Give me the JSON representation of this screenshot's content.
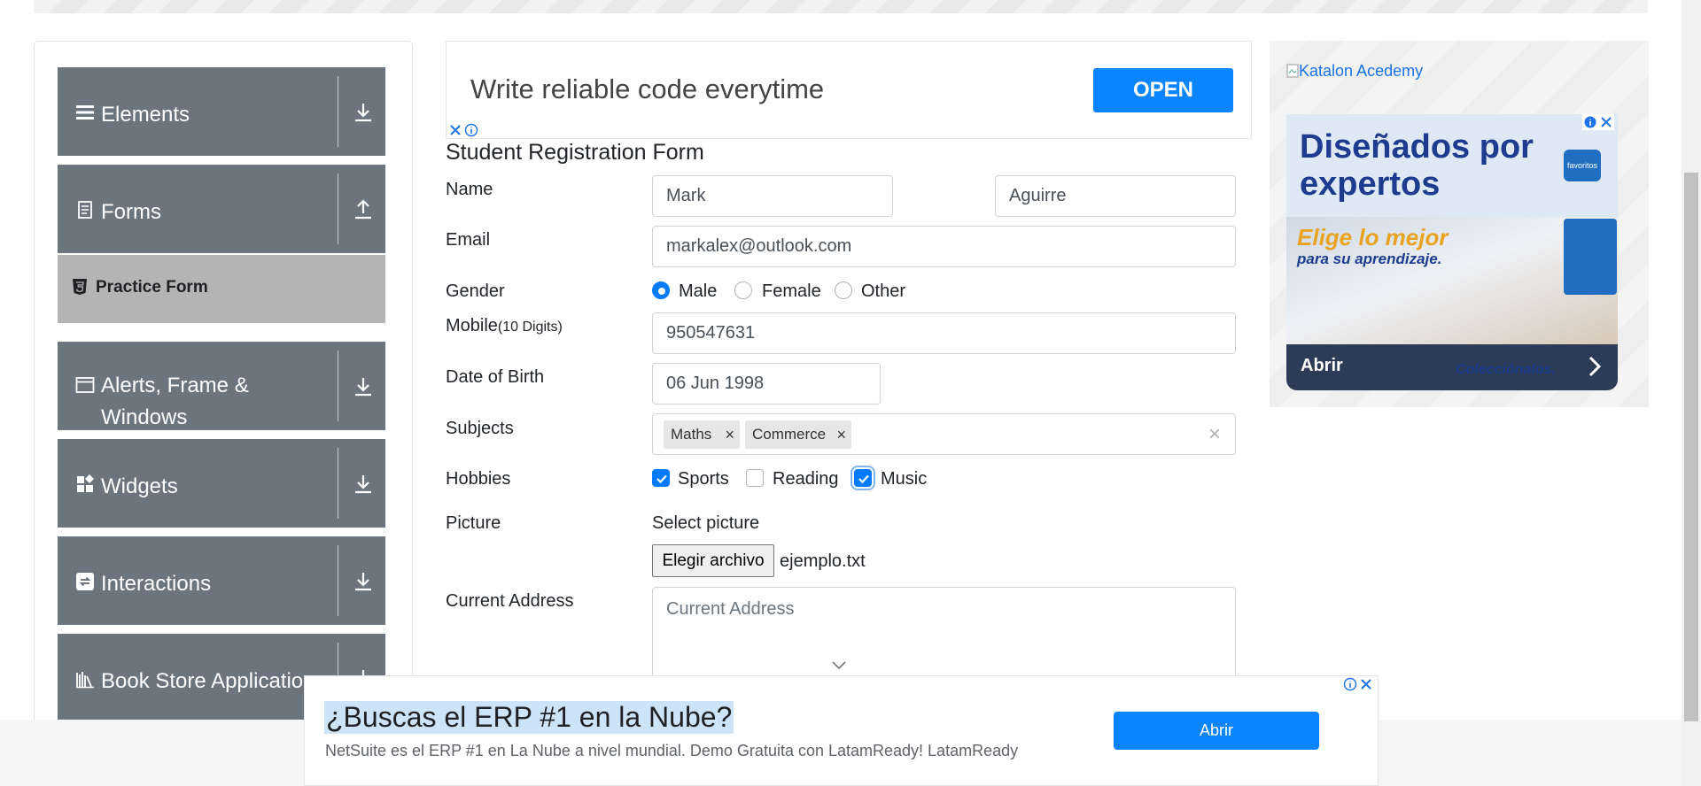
{
  "sidebar": {
    "groups": [
      {
        "label": "Elements",
        "icon": "hamburger-icon",
        "arrow": "download-arrow-icon"
      },
      {
        "label": "Forms",
        "icon": "document-icon",
        "arrow": "upload-arrow-icon"
      },
      {
        "label": "Alerts, Frame & Windows",
        "icon": "window-icon",
        "arrow": "download-arrow-icon"
      },
      {
        "label": "Widgets",
        "icon": "widgets-icon",
        "arrow": "download-arrow-icon"
      },
      {
        "label": "Interactions",
        "icon": "interactions-icon",
        "arrow": "download-arrow-icon"
      },
      {
        "label": "Book Store Application",
        "icon": "books-icon",
        "arrow": "download-arrow-icon"
      }
    ],
    "active_item": {
      "label": "Practice Form",
      "icon": "html5-icon"
    }
  },
  "top_ad": {
    "text": "Write reliable code everytime",
    "button": "OPEN"
  },
  "form": {
    "title": "Student Registration Form",
    "name_label": "Name",
    "first_name": "Mark",
    "last_name": "Aguirre",
    "email_label": "Email",
    "email": "markalex@outlook.com",
    "gender_label": "Gender",
    "gender_options": [
      "Male",
      "Female",
      "Other"
    ],
    "gender_selected": "Male",
    "mobile_label": "Mobile",
    "mobile_hint": "(10 Digits)",
    "mobile": "950547631",
    "dob_label": "Date of Birth",
    "dob": "06 Jun 1998",
    "subjects_label": "Subjects",
    "subjects": [
      "Maths",
      "Commerce"
    ],
    "subjects_clear": "×",
    "hobbies_label": "Hobbies",
    "hobbies": [
      {
        "label": "Sports",
        "checked": true
      },
      {
        "label": "Reading",
        "checked": false
      },
      {
        "label": "Music",
        "checked": true
      }
    ],
    "picture_label": "Picture",
    "select_picture": "Select picture",
    "file_button": "Elegir archivo",
    "file_name": "ejemplo.txt",
    "address_label": "Current Address",
    "address_placeholder": "Current Address"
  },
  "right_ad": {
    "katalon_alt": "Katalon Acedemy",
    "title_line1": "Diseñados por",
    "title_line2": "expertos",
    "sub1": "Elige lo mejor",
    "sub2": "para su aprendizaje.",
    "logo_text": "favoritos",
    "cta": "Abrir",
    "tagline": "Colecciónalos."
  },
  "bottom_ad": {
    "title": "¿Buscas el ERP #1 en la Nube?",
    "description": "NetSuite es el ERP #1 en La Nube a nivel mundial. Demo Gratuita con LatamReady! LatamReady",
    "button": "Abrir"
  },
  "colors": {
    "sidebar_header": "#6c757d",
    "sidebar_active": "#b4b4b4",
    "primary": "#007bff",
    "ad_button": "#0a84ff"
  }
}
